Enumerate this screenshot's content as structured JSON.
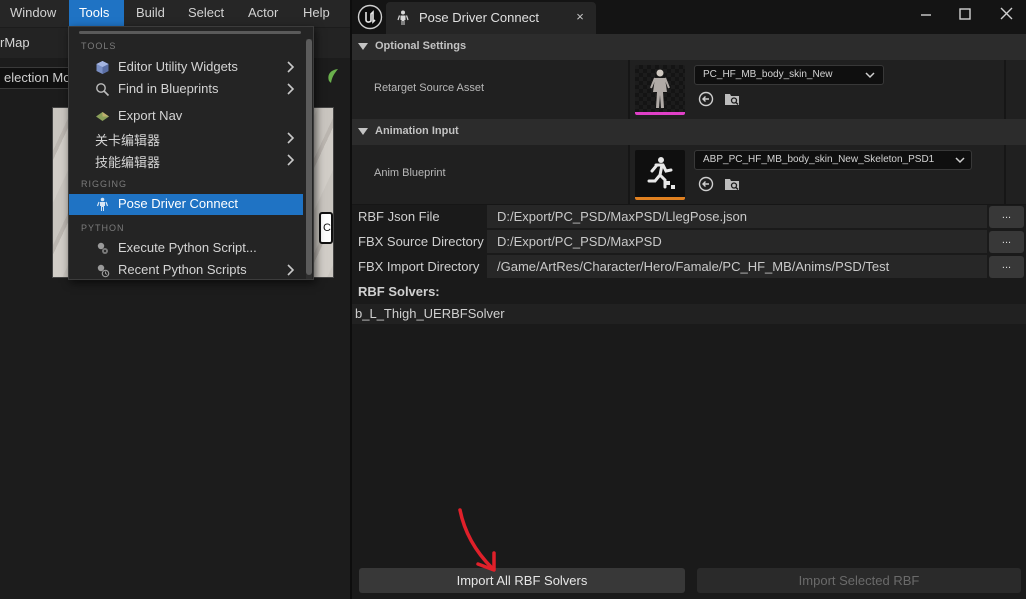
{
  "menubar": {
    "items": [
      "Window",
      "Tools",
      "Build",
      "Select",
      "Actor",
      "Help"
    ]
  },
  "editor": {
    "map_label": "rMap",
    "selection_mode": "election Mo",
    "viewport_button": "C"
  },
  "tools_menu": {
    "sections": {
      "tools": "TOOLS",
      "rigging": "RIGGING",
      "python": "PYTHON"
    },
    "items": {
      "editor_utility_widgets": "Editor Utility Widgets",
      "find_in_blueprints": "Find in Blueprints",
      "export_nav": "Export Nav",
      "level_editor_cn": "关卡编辑器",
      "skill_editor_cn": "技能编辑器",
      "pose_driver_connect": "Pose Driver Connect",
      "execute_python_script": "Execute Python Script...",
      "recent_python_scripts": "Recent Python Scripts"
    }
  },
  "window": {
    "tab_title": "Pose Driver Connect",
    "tab_close": "×",
    "sections": {
      "optional_settings": "Optional Settings",
      "animation_input": "Animation Input"
    },
    "retarget_source": {
      "label": "Retarget Source Asset",
      "asset": "PC_HF_MB_body_skin_New",
      "accent": "#e040c8"
    },
    "anim_blueprint": {
      "label": "Anim Blueprint",
      "asset": "ABP_PC_HF_MB_body_skin_New_Skeleton_PSD1",
      "accent": "#e08020"
    },
    "paths": [
      {
        "label": "RBF Json File",
        "value": "D:/Export/PC_PSD/MaxPSD/LlegPose.json",
        "button": "..."
      },
      {
        "label": "FBX Source Directory",
        "value": "D:/Export/PC_PSD/MaxPSD",
        "button": "..."
      },
      {
        "label": "FBX Import Directory",
        "value": "/Game/ArtRes/Character/Hero/Famale/PC_HF_MB/Anims/PSD/Test",
        "button": "..."
      }
    ],
    "rbf_solvers_header": "RBF Solvers:",
    "rbf_solvers": [
      "b_L_Thigh_UERBFSolver"
    ],
    "buttons": {
      "import_all": "Import All RBF Solvers",
      "import_selected": "Import Selected RBF"
    }
  },
  "colors": {
    "selection_blue": "#1f73c4",
    "annotation_red": "#e0202a"
  }
}
